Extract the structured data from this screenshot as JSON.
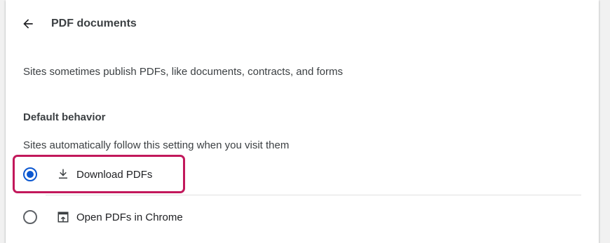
{
  "header": {
    "title": "PDF documents",
    "back_icon": "arrow-back-icon"
  },
  "description": "Sites sometimes publish PDFs, like documents, contracts, and forms",
  "default_behavior": {
    "heading": "Default behavior",
    "subtext": "Sites automatically follow this setting when you visit them",
    "options": [
      {
        "label": "Download PDFs",
        "icon": "download-icon",
        "selected": true
      },
      {
        "label": "Open PDFs in Chrome",
        "icon": "open-in-browser-icon",
        "selected": false
      }
    ]
  },
  "colors": {
    "accent": "#0b57d0",
    "highlight": "#c2185b"
  }
}
